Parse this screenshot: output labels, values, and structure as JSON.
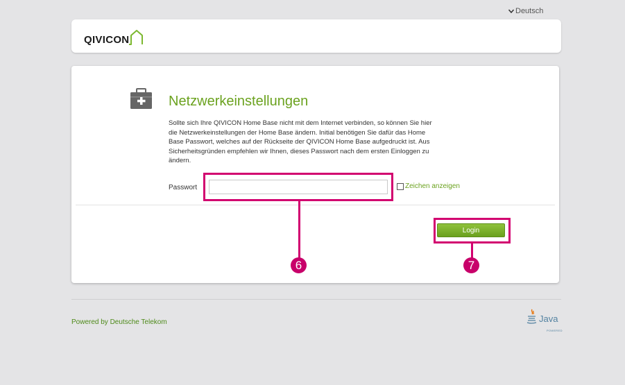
{
  "language": {
    "label": "Deutsch"
  },
  "header": {
    "logo": "QIVICON"
  },
  "main": {
    "title": "Netzwerkeinstellungen",
    "description": "Sollte sich Ihre QIVICON Home Base nicht mit dem Internet verbinden, so können Sie hier die Netzwerkeinstellungen der Home Base ändern. Initial benötigen Sie dafür das Home Base Passwort, welches auf der Rückseite der QIVICON Home Base aufgedruckt ist. Aus Sicherheitsgründen empfehlen wir Ihnen, dieses Passwort nach dem ersten Einloggen zu ändern.",
    "password_label": "Passwort",
    "password_value": "",
    "show_chars_label": "Zeichen anzeigen",
    "login_label": "Login"
  },
  "callouts": {
    "six": "6",
    "seven": "7"
  },
  "footer": {
    "powered_by": "Powered by Deutsche Telekom",
    "java_label": "Java",
    "java_sub": "POWERED"
  },
  "colors": {
    "accent_green": "#6ba21f",
    "highlight": "#d2006f"
  },
  "icons": {
    "language": "chevron-down-icon",
    "section": "toolbox-icon",
    "logo": "house-outline-icon"
  }
}
